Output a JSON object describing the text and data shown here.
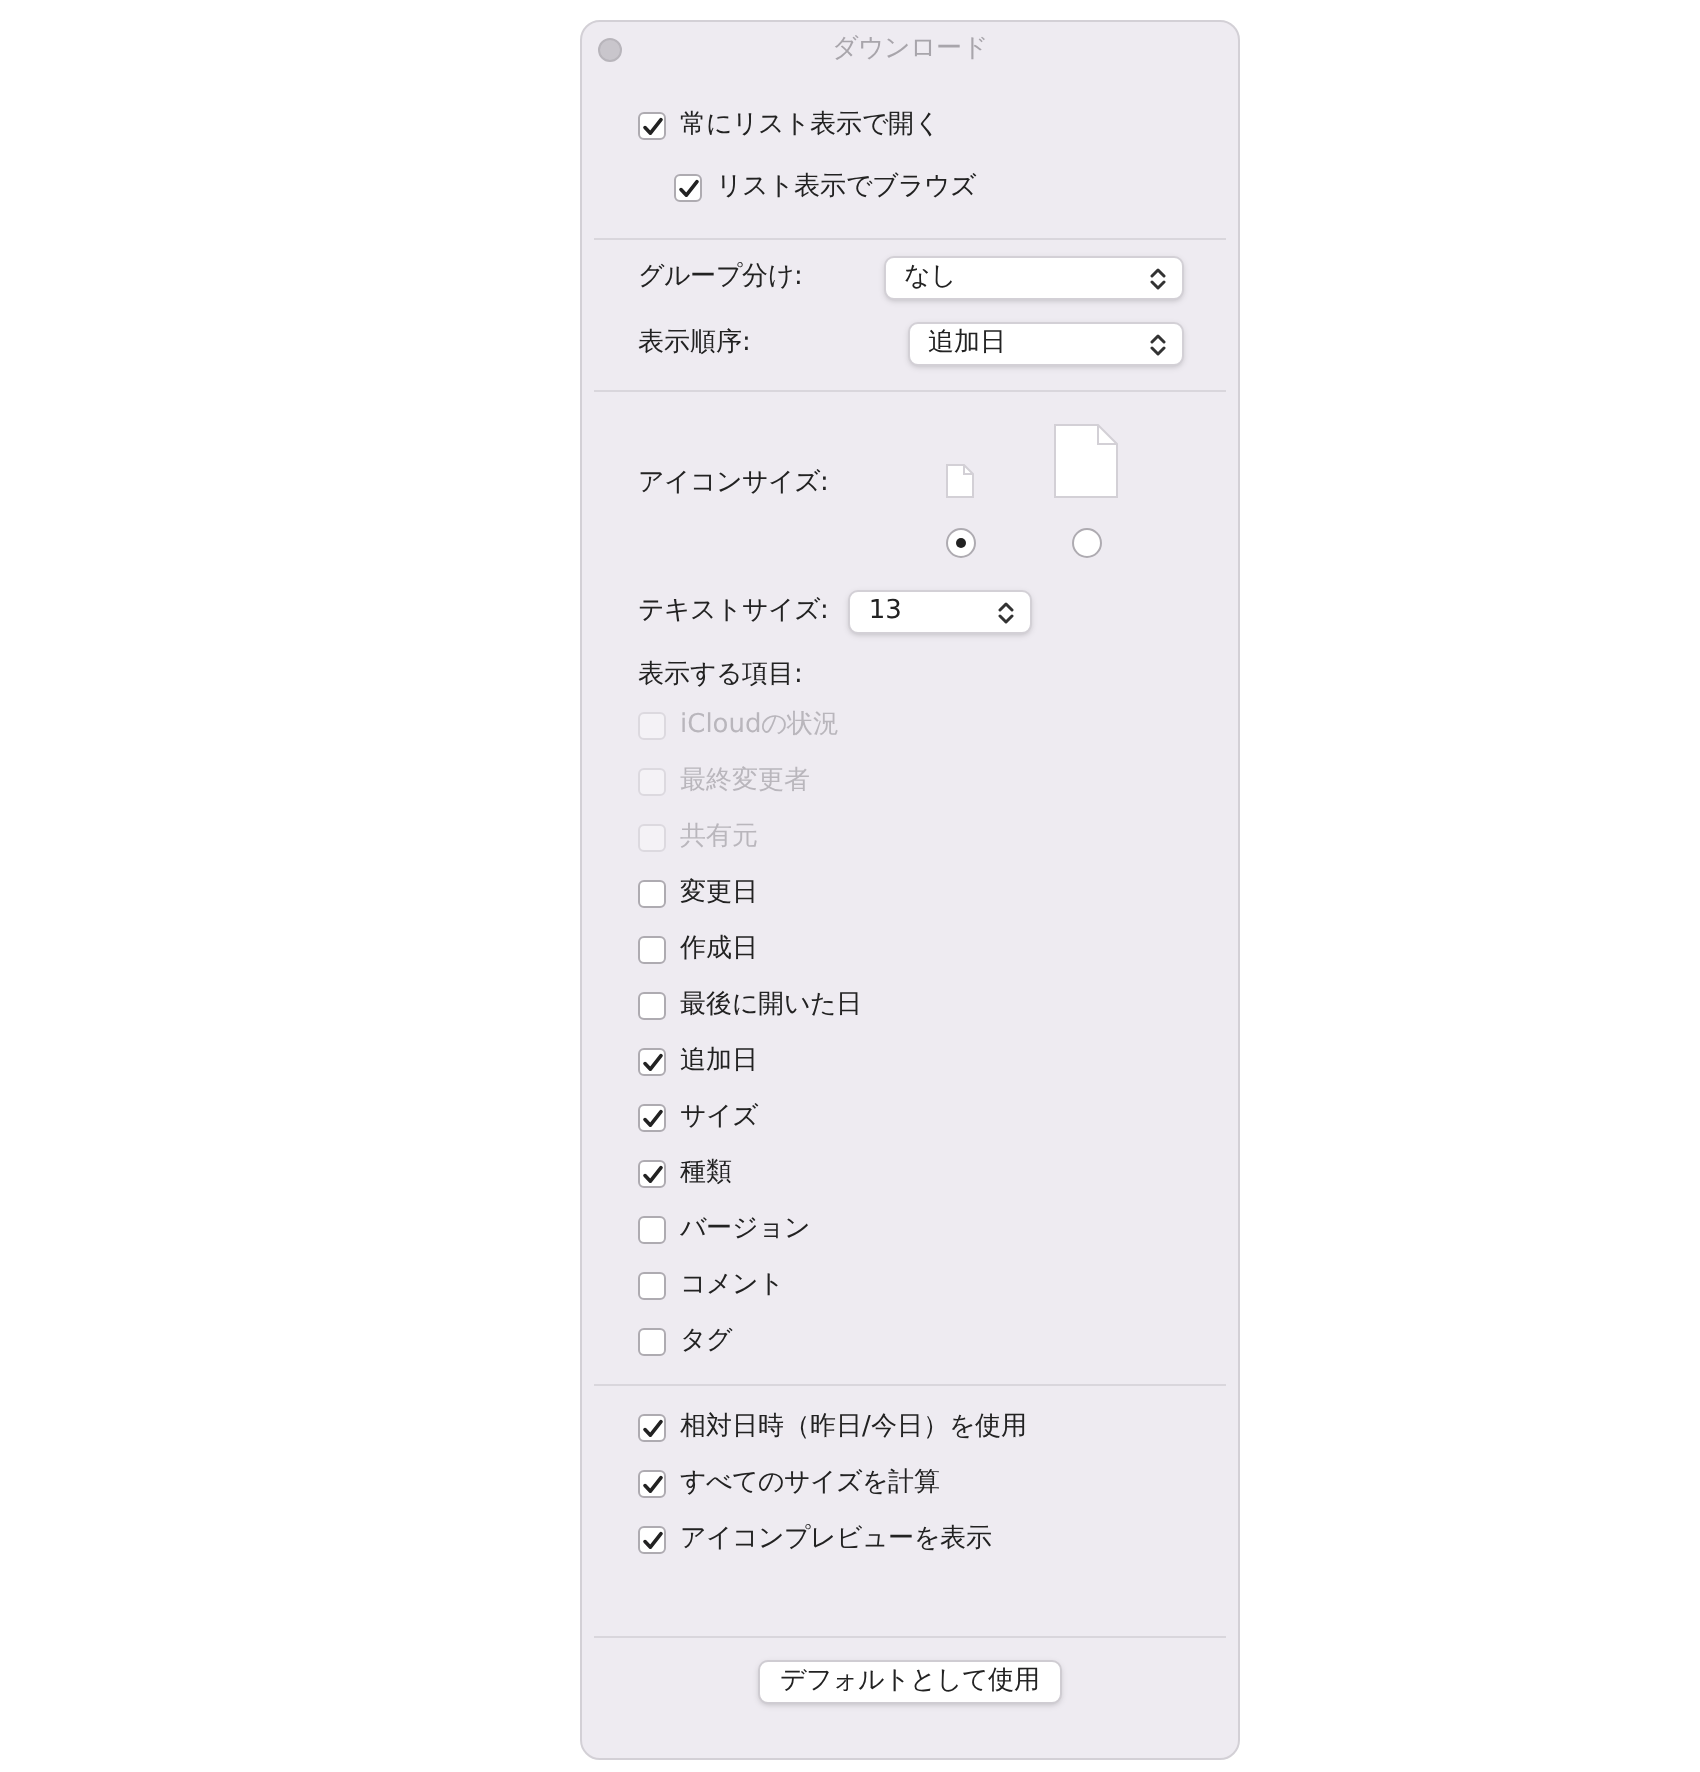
{
  "window": {
    "title": "ダウンロード"
  },
  "open_options": [
    {
      "label": "常にリスト表示で開く",
      "checked": true,
      "children": [
        {
          "label": "リスト表示でブラウズ",
          "checked": true
        }
      ]
    }
  ],
  "group_by": {
    "label": "グループ分け:",
    "value": "なし"
  },
  "sort_by": {
    "label": "表示順序:",
    "value": "追加日"
  },
  "icon_size": {
    "label": "アイコンサイズ:",
    "options": [
      {
        "kind": "small",
        "selected": true
      },
      {
        "kind": "large",
        "selected": false
      }
    ]
  },
  "text_size": {
    "label": "テキストサイズ:",
    "value": "13"
  },
  "columns": {
    "label": "表示する項目:",
    "items": [
      {
        "label": "iCloudの状況",
        "checked": false,
        "disabled": true
      },
      {
        "label": "最終変更者",
        "checked": false,
        "disabled": true
      },
      {
        "label": "共有元",
        "checked": false,
        "disabled": true
      },
      {
        "label": "変更日",
        "checked": false,
        "disabled": false
      },
      {
        "label": "作成日",
        "checked": false,
        "disabled": false
      },
      {
        "label": "最後に開いた日",
        "checked": false,
        "disabled": false
      },
      {
        "label": "追加日",
        "checked": true,
        "disabled": false
      },
      {
        "label": "サイズ",
        "checked": true,
        "disabled": false
      },
      {
        "label": "種類",
        "checked": true,
        "disabled": false
      },
      {
        "label": "バージョン",
        "checked": false,
        "disabled": false
      },
      {
        "label": "コメント",
        "checked": false,
        "disabled": false
      },
      {
        "label": "タグ",
        "checked": false,
        "disabled": false
      }
    ]
  },
  "options": [
    {
      "label": "相対日時（昨日/今日）を使用",
      "checked": true
    },
    {
      "label": "すべてのサイズを計算",
      "checked": true
    },
    {
      "label": "アイコンプレビューを表示",
      "checked": true
    }
  ],
  "button": "デフォルトとして使用"
}
